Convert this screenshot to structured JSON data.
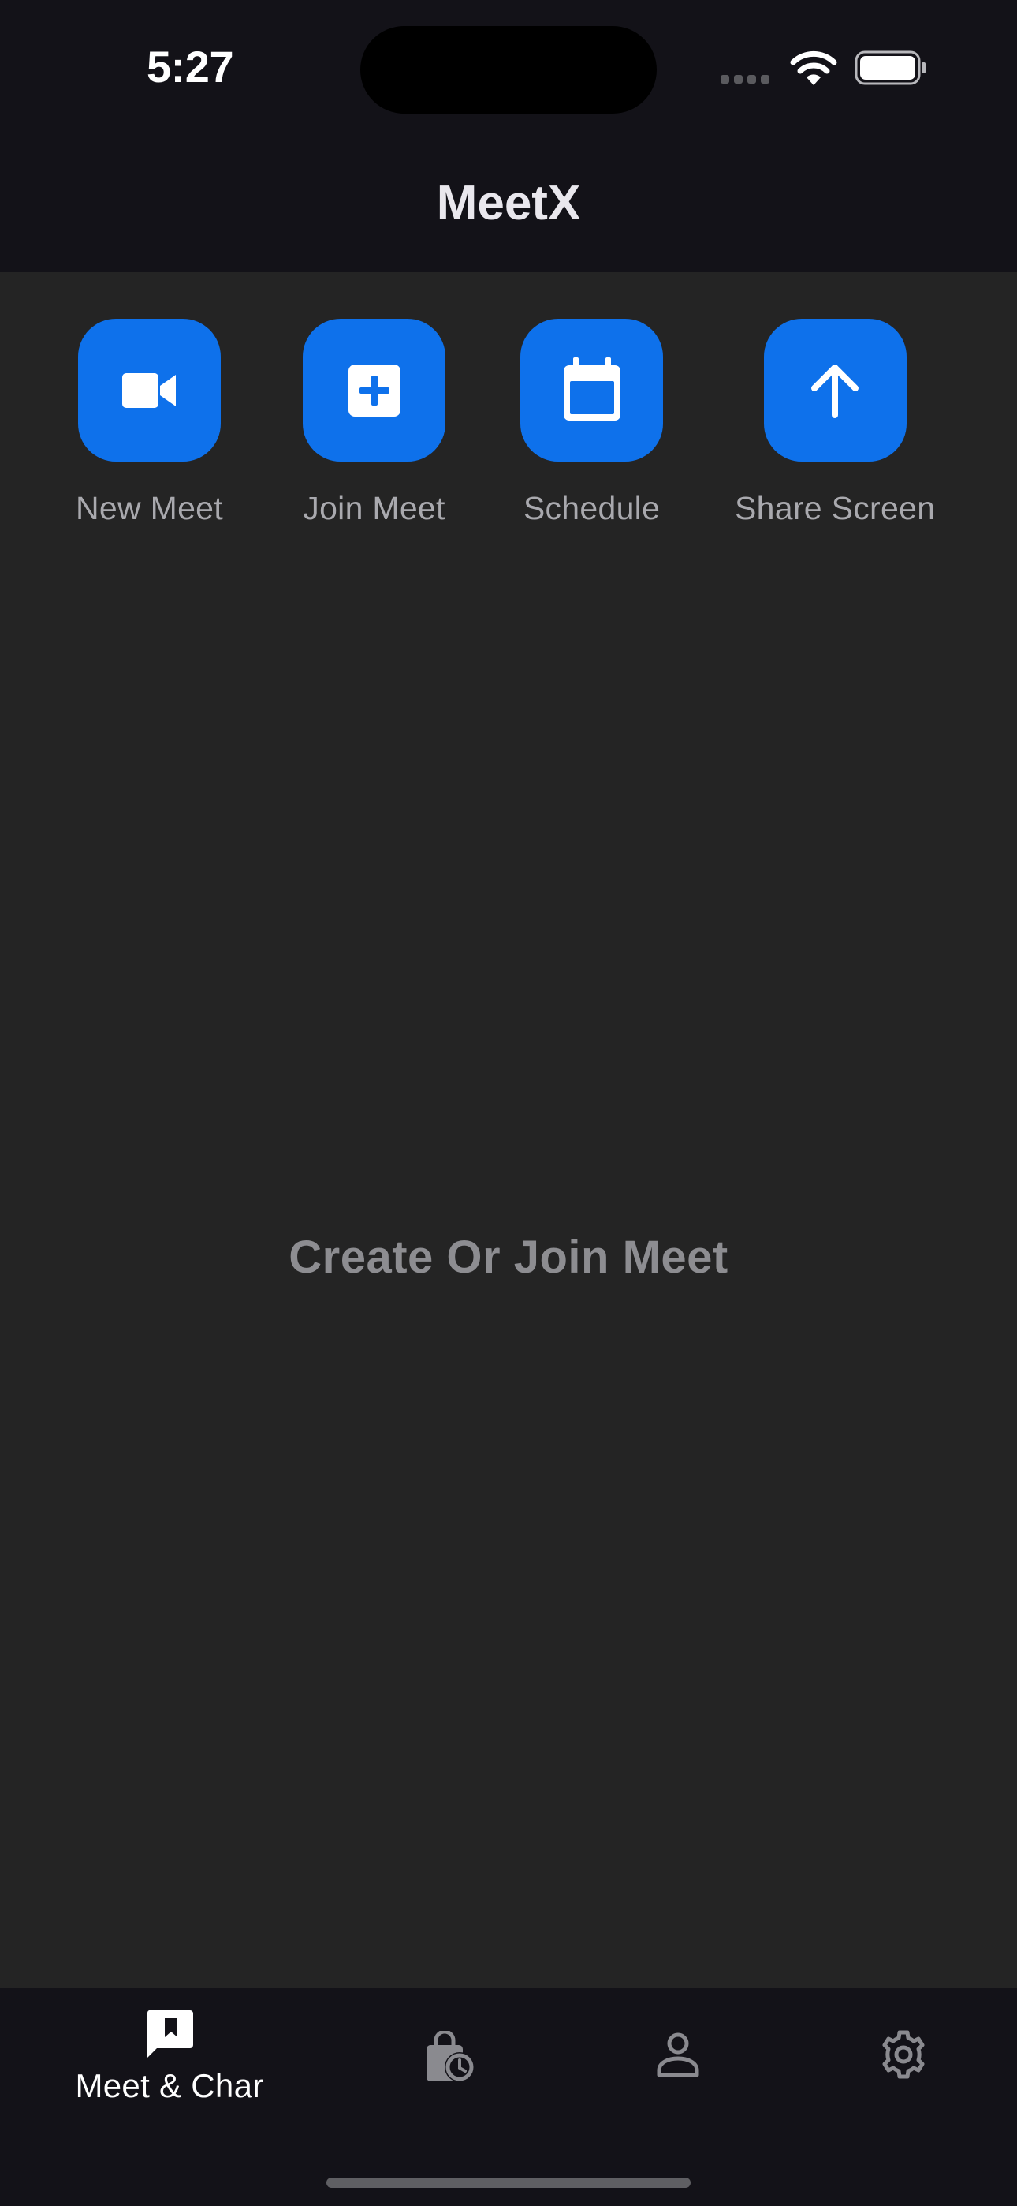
{
  "status_bar": {
    "time": "5:27",
    "icons": [
      "cellular-signal-icon",
      "wifi-icon",
      "battery-icon"
    ]
  },
  "header": {
    "title": "MeetX"
  },
  "actions": [
    {
      "label": "New Meet",
      "icon": "video-camera-icon"
    },
    {
      "label": "Join Meet",
      "icon": "plus-square-icon"
    },
    {
      "label": "Schedule",
      "icon": "calendar-icon"
    },
    {
      "label": "Share Screen",
      "icon": "arrow-up-icon"
    }
  ],
  "main": {
    "empty_message": "Create Or Join Meet"
  },
  "bottom_nav": {
    "items": [
      {
        "label": "Meet & Char",
        "icon": "chat-bookmark-icon",
        "active": true
      },
      {
        "label": "",
        "icon": "history-bag-icon",
        "active": false
      },
      {
        "label": "",
        "icon": "person-icon",
        "active": false
      },
      {
        "label": "",
        "icon": "gear-icon",
        "active": false
      }
    ]
  },
  "colors": {
    "accent": "#0e71eb",
    "background": "#242424",
    "bar_background": "#131218",
    "muted_text": "#a9a9ae"
  }
}
